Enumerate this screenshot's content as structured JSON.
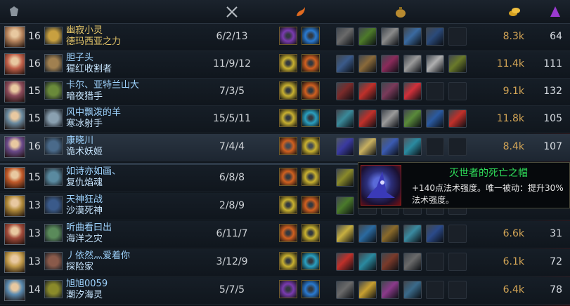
{
  "header": {
    "icons": [
      "team-crest-icon",
      "kda-swords-icon",
      "summoner-spell-flame-icon",
      "gold-pouch-icon",
      "gold-coins-icon",
      "creep-score-icon"
    ]
  },
  "players": [
    {
      "level": "16",
      "player": "幽寂小灵",
      "champion": "德玛西亚之力",
      "kda": "6/2/13",
      "gold": "8.3k",
      "cs": "64",
      "highlight": true,
      "portrait": "#b7855e",
      "emblem": "#c8a040",
      "spells": [
        "#7a3bb0",
        "#2a7ad0"
      ],
      "items": [
        "#6a6a6a",
        "#4d7a2a",
        "#8a8a8a",
        "#3a6aa0",
        "#2a4a7a",
        "empty"
      ]
    },
    {
      "level": "16",
      "player": "胆子头",
      "champion": "猩红收割者",
      "kda": "11/9/12",
      "gold": "11.4k",
      "cs": "111",
      "highlight": false,
      "portrait": "#c0604a",
      "emblem": "#a08050",
      "spells": [
        "#c8b030",
        "#d06020"
      ],
      "items": [
        "#3a5a8a",
        "#8a6a3a",
        "#8a2a5a",
        "#9a9a9a",
        "#b0b0b0",
        "#6a7a2a"
      ]
    },
    {
      "level": "15",
      "player": "卡尔、亚特兰山大",
      "champion": "暗夜猎手",
      "kda": "7/3/5",
      "gold": "9.1k",
      "cs": "132",
      "highlight": false,
      "portrait": "#8a4a5a",
      "emblem": "#6a8a3a",
      "spells": [
        "#c8b030",
        "#d06020"
      ],
      "items": [
        "#7a2a2a",
        "#c0302a",
        "#7a3a5a",
        "#d0303a",
        "empty",
        "empty"
      ]
    },
    {
      "level": "15",
      "player": "风中飘泼的羊",
      "champion": "寒冰射手",
      "kda": "15/5/11",
      "gold": "11.8k",
      "cs": "105",
      "highlight": false,
      "portrait": "#6a8aa0",
      "emblem": "#8aa0b0",
      "spells": [
        "#c8b030",
        "#2aa0c0"
      ],
      "items": [
        "#3a8a9a",
        "#c0302a",
        "#9a9a9a",
        "#5a8a3a",
        "#2a5aa0",
        "#c0302a"
      ]
    },
    {
      "level": "16",
      "player": "康晓川",
      "champion": "诡术妖姬",
      "kda": "7/4/4",
      "gold": "8.4k",
      "cs": "107",
      "highlight": false,
      "selected": true,
      "portrait": "#6a4a8a",
      "emblem": "#4a6a8a",
      "spells": [
        "#d06020",
        "#c8b030"
      ],
      "items": [
        "#3a3aa0",
        "#c8b060",
        "#3a5ab0",
        "#2a8aa0",
        "empty",
        "empty"
      ]
    },
    {
      "level": "15",
      "player": "如诗亦如画、",
      "champion": "复仇焰魂",
      "kda": "6/8/8",
      "gold": "",
      "cs": "",
      "highlight": false,
      "portrait": "#c05a2a",
      "emblem": "#5a8aa0",
      "spells": [
        "#d06020",
        "#c8b030"
      ],
      "items": [
        "#8a8a2a",
        "empty",
        "empty",
        "empty",
        "empty",
        "empty"
      ]
    },
    {
      "level": "13",
      "player": "天神狂战",
      "champion": "沙漠死神",
      "kda": "2/8/9",
      "gold": "",
      "cs": "",
      "highlight": false,
      "portrait": "#b08a3a",
      "emblem": "#3a5a8a",
      "spells": [
        "#c8b030",
        "#d06020"
      ],
      "items": [
        "#4a7a2a",
        "empty",
        "empty",
        "empty",
        "empty",
        "empty"
      ]
    },
    {
      "level": "13",
      "player": "听曲看曰出",
      "champion": "海洋之灾",
      "kda": "6/11/7",
      "gold": "6.6k",
      "cs": "31",
      "highlight": false,
      "portrait": "#a04a3a",
      "emblem": "#5a8a5a",
      "spells": [
        "#d06020",
        "#c8b030"
      ],
      "items": [
        "#c8b040",
        "#2a6aa0",
        "#8a6a2a",
        "#3a8aa0",
        "#2a4a8a",
        "empty"
      ]
    },
    {
      "level": "13",
      "player": "丿依然灬爱着你",
      "champion": "探险家",
      "kda": "3/12/9",
      "gold": "6.1k",
      "cs": "72",
      "highlight": false,
      "portrait": "#c09a4a",
      "emblem": "#8a5a4a",
      "spells": [
        "#c8b030",
        "#2aa0c0"
      ],
      "items": [
        "#c0302a",
        "#2a8aa0",
        "#7a3a2a",
        "#6a6a6a",
        "empty",
        "empty"
      ]
    },
    {
      "level": "14",
      "player": "旭旭0059",
      "champion": "潮汐海灵",
      "kda": "5/7/5",
      "gold": "6.4k",
      "cs": "78",
      "highlight": false,
      "portrait": "#5a8ab0",
      "emblem": "#8a8a2a",
      "spells": [
        "#7a3bb0",
        "#2a7ad0"
      ],
      "items": [
        "#6a6a6a",
        "#c8a030",
        "#8a3a8a",
        "#3a6a8a",
        "empty",
        "empty"
      ]
    }
  ],
  "tooltip": {
    "title": "灭世者的死亡之帽",
    "description": "+140点法术强度。唯一被动：提升30%法术强度。"
  }
}
